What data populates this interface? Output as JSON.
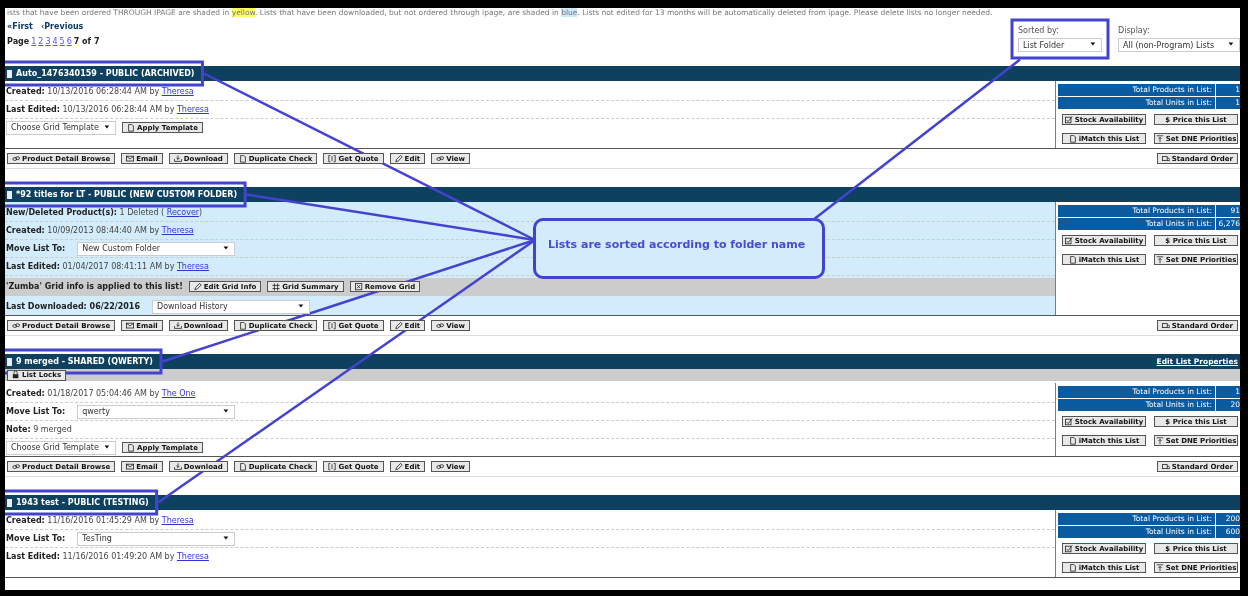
{
  "notice": [
    {
      "text": "ists that have been ordered THROUGH IPAGE are shaded in ",
      "kind": "plain"
    },
    {
      "text": "yellow",
      "kind": "yellow"
    },
    {
      "text": ". Lists that have been downloaded, but not ordered through ipage, are shaded in ",
      "kind": "plain"
    },
    {
      "text": "blue",
      "kind": "blue"
    },
    {
      "text": ". Lists not edited for 13 months will be automatically deleted from ipage. Please delete lists no longer needed.",
      "kind": "plain"
    }
  ],
  "pager": {
    "first": "«First",
    "previous": "‹Previous",
    "label": "Page",
    "pages": [
      "1",
      "2",
      "3",
      "4",
      "5",
      "6"
    ],
    "current": "7 of 7"
  },
  "sort": {
    "label": "Sorted by:",
    "value": "List Folder",
    "highlighted": true
  },
  "display": {
    "label": "Display:",
    "value": "All (non-Program) Lists"
  },
  "lists": [
    {
      "title": "Auto_1476340159 - PUBLIC  (ARCHIVED)",
      "checked": false,
      "highlighted": true,
      "color": "#ffffff",
      "rows": [
        {
          "kind": "info",
          "label": "Created:",
          "text": "10/13/2016 06:28:44 AM by",
          "link": "Theresa"
        },
        {
          "kind": "info",
          "label": "Last Edited:",
          "text": "10/13/2016 06:28:44 AM by",
          "link": "Theresa"
        },
        {
          "kind": "template",
          "select": "Choose Grid Template",
          "button": "Apply Template"
        }
      ],
      "stats": [
        {
          "label": "Total Products in List:",
          "value": "1"
        },
        {
          "label": "Total Units in List:",
          "value": "1"
        }
      ],
      "side_buttons": [
        "Stock Availability",
        "$ Price this List",
        "iMatch this List",
        "Set DNE Priorities"
      ],
      "actions": [
        "Product Detail Browse",
        "Email",
        "Download",
        "Duplicate Check",
        "Get Quote",
        "Edit",
        "View"
      ],
      "order_button": "Standard Order"
    },
    {
      "title": "*92 titles for LT - PUBLIC  (NEW CUSTOM FOLDER)",
      "checked": false,
      "highlighted": true,
      "color": "#d2ecfc",
      "rows": [
        {
          "kind": "info",
          "label": "New/Deleted Product(s):",
          "text": "1 Deleted (",
          "link": "Recover",
          "tail": ")"
        },
        {
          "kind": "info",
          "label": "Created:",
          "text": "10/09/2013 08:44:40 AM by",
          "link": "Theresa"
        },
        {
          "kind": "move",
          "label": "Move List To:",
          "select": "New Custom Folder"
        },
        {
          "kind": "info",
          "label": "Last Edited:",
          "text": "01/04/2017 08:41:11 AM by",
          "link": "Theresa"
        },
        {
          "kind": "grid",
          "text": "'Zumba' Grid info is applied to this list!",
          "buttons": [
            "Edit Grid Info",
            "Grid Summary",
            "Remove Grid"
          ]
        },
        {
          "kind": "move",
          "label": "Last Downloaded: 06/22/2016",
          "select": "Download History"
        }
      ],
      "stats": [
        {
          "label": "Total Products in List:",
          "value": "91"
        },
        {
          "label": "Total Units in List:",
          "value": "6,276"
        }
      ],
      "side_buttons": [
        "Stock Availability",
        "$ Price this List",
        "iMatch this List",
        "Set DNE Priorities"
      ],
      "actions": [
        "Product Detail Browse",
        "Email",
        "Download",
        "Duplicate Check",
        "Get Quote",
        "Edit",
        "View"
      ],
      "order_button": "Standard Order"
    },
    {
      "title": "9 merged - SHARED  (QWERTY)",
      "checked": false,
      "highlighted": true,
      "color": "#ffffff",
      "edit_link": "Edit List Properties",
      "lock_button": "List Locks",
      "rows": [
        {
          "kind": "info",
          "label": "Created:",
          "text": "01/18/2017 05:04:46 AM by",
          "link": "The One"
        },
        {
          "kind": "move",
          "label": "Move List To:",
          "select": "qwerty"
        },
        {
          "kind": "info",
          "label": "Note:",
          "text": "9 merged"
        },
        {
          "kind": "template",
          "select": "Choose Grid Template",
          "button": "Apply Template"
        }
      ],
      "stats": [
        {
          "label": "Total Products in List:",
          "value": "1"
        },
        {
          "label": "Total Units in List:",
          "value": "20"
        }
      ],
      "side_buttons": [
        "Stock Availability",
        "$ Price this List",
        "iMatch this List",
        "Set DNE Priorities"
      ],
      "actions": [
        "Product Detail Browse",
        "Email",
        "Download",
        "Duplicate Check",
        "Get Quote",
        "Edit",
        "View"
      ],
      "order_button": "Standard Order"
    },
    {
      "title": "1943 test - PUBLIC  (TESTING)",
      "checked": false,
      "highlighted": true,
      "color": "#ffffff",
      "rows": [
        {
          "kind": "info",
          "label": "Created:",
          "text": "11/16/2016 01:45:29 AM by",
          "link": "Theresa"
        },
        {
          "kind": "move",
          "label": "Move List To:",
          "select": "TesTing"
        },
        {
          "kind": "info",
          "label": "Last Edited:",
          "text": "11/16/2016 01:49:20 AM by",
          "link": "Theresa"
        }
      ],
      "stats": [
        {
          "label": "Total Products in List:",
          "value": "200"
        },
        {
          "label": "Total Units in List:",
          "value": "600"
        }
      ],
      "side_buttons": [
        "Stock Availability",
        "$ Price this List",
        "iMatch this List",
        "Set DNE Priorities"
      ]
    }
  ],
  "callout": "Lists are sorted according to folder name"
}
